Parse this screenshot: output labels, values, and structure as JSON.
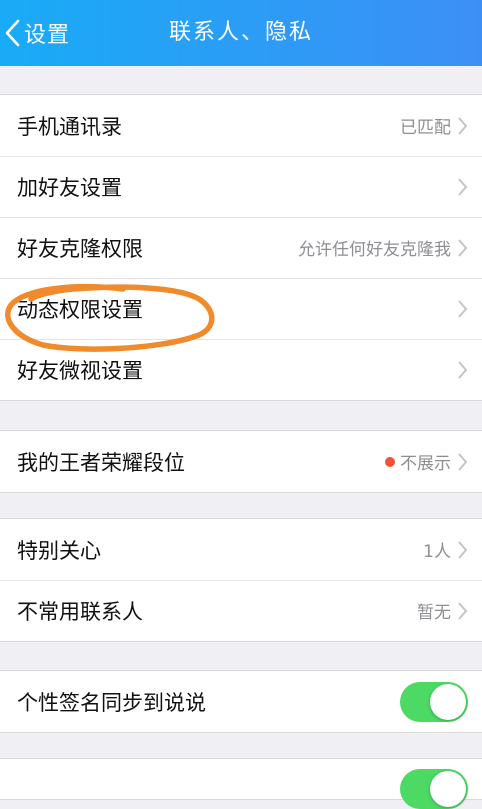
{
  "nav": {
    "back_label": "设置",
    "title": "联系人、隐私",
    "back_icon": "chevron-left-icon",
    "gradient_start": "#19abf6",
    "gradient_end": "#3d8ff6"
  },
  "group1": [
    {
      "label": "手机通讯录",
      "value": "已匹配"
    },
    {
      "label": "加好友设置",
      "value": ""
    },
    {
      "label": "好友克隆权限",
      "value": "允许任何好友克隆我"
    },
    {
      "label": "动态权限设置",
      "value": ""
    },
    {
      "label": "好友微视设置",
      "value": ""
    }
  ],
  "group2": [
    {
      "label": "我的王者荣耀段位",
      "value": "不展示",
      "dot_color": "#f05236"
    }
  ],
  "group3": [
    {
      "label": "特别关心",
      "value": "1人"
    },
    {
      "label": "不常用联系人",
      "value": "暂无"
    }
  ],
  "group4": [
    {
      "label": "个性签名同步到说说",
      "toggle_on": true,
      "toggle_color": "#4cd964"
    }
  ],
  "annotation": {
    "shape": "orange-hand-drawn-circle",
    "color": "#f08a2c"
  }
}
